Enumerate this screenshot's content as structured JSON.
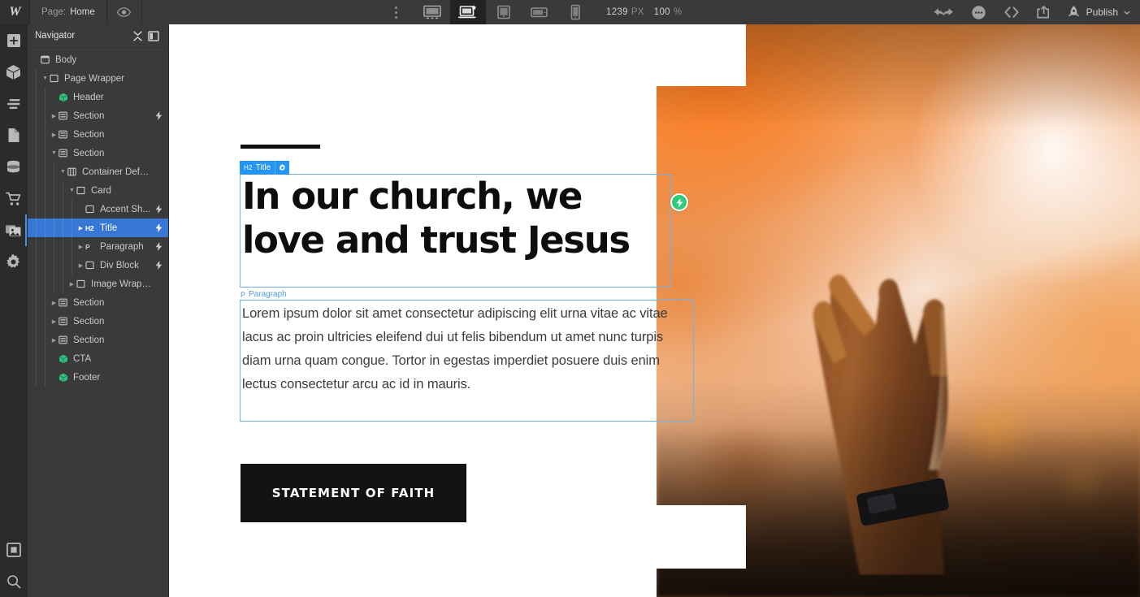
{
  "topbar": {
    "logo": "W",
    "page_label": "Page:",
    "page_value": "Home",
    "eye_icon": "eye-icon",
    "menu_icon": "vertical-dots-icon",
    "devices": [
      {
        "name": "desktop",
        "icon": "monitor-icon",
        "active": false
      },
      {
        "name": "base-breakpoint",
        "icon": "laptop-star-icon",
        "active": true
      },
      {
        "name": "tablet",
        "icon": "tablet-icon",
        "active": false
      },
      {
        "name": "mobile-landscape",
        "icon": "mobile-landscape-icon",
        "active": false
      },
      {
        "name": "mobile-portrait",
        "icon": "mobile-portrait-icon",
        "active": false
      }
    ],
    "viewport_width": "1239",
    "viewport_unit": "PX",
    "zoom_value": "100",
    "zoom_unit": "%",
    "undo_icon": "undo-arrow-icon",
    "redo_icon": "redo-arrow-icon",
    "comments_icon": "comment-bubble-icon",
    "code_icon": "code-brackets-icon",
    "share_icon": "share-export-icon",
    "rocket_icon": "rocket-icon",
    "publish_label": "Publish",
    "publish_chevron": "chevron-down-icon"
  },
  "rail": {
    "items": [
      {
        "name": "add-elements",
        "icon": "plus-square-icon",
        "active": false
      },
      {
        "name": "components",
        "icon": "cube-icon",
        "active": false
      },
      {
        "name": "navigator",
        "icon": "layers-list-icon",
        "active": false
      },
      {
        "name": "pages",
        "icon": "page-icon",
        "active": false
      },
      {
        "name": "cms",
        "icon": "database-icon",
        "active": false
      },
      {
        "name": "ecommerce",
        "icon": "shopping-cart-icon",
        "active": false
      },
      {
        "name": "assets",
        "icon": "image-stack-icon",
        "active": true
      },
      {
        "name": "settings",
        "icon": "gear-icon",
        "active": false
      }
    ],
    "bottom_items": [
      {
        "name": "audit-panel",
        "icon": "square-outline-icon"
      },
      {
        "name": "search",
        "icon": "magnifier-icon"
      }
    ]
  },
  "navigator": {
    "title": "Navigator",
    "collapse_icon": "collapse-all-icon",
    "panel_icon": "panel-toggle-icon",
    "tree": [
      {
        "label": "Body",
        "depth": 0,
        "icon": "body-icon",
        "arrow": "none",
        "bolt": false,
        "selected": false
      },
      {
        "label": "Page Wrapper",
        "depth": 1,
        "icon": "div-icon",
        "arrow": "down",
        "bolt": false,
        "selected": false
      },
      {
        "label": "Header",
        "depth": 2,
        "icon": "component-icon",
        "arrow": "none",
        "bolt": false,
        "selected": false
      },
      {
        "label": "Section",
        "depth": 2,
        "icon": "section-icon",
        "arrow": "right",
        "bolt": true,
        "selected": false
      },
      {
        "label": "Section",
        "depth": 2,
        "icon": "section-icon",
        "arrow": "right",
        "bolt": false,
        "selected": false
      },
      {
        "label": "Section",
        "depth": 2,
        "icon": "section-icon",
        "arrow": "down",
        "bolt": false,
        "selected": false
      },
      {
        "label": "Container Default",
        "depth": 3,
        "icon": "container-icon",
        "arrow": "down",
        "bolt": false,
        "selected": false
      },
      {
        "label": "Card",
        "depth": 4,
        "icon": "div-icon",
        "arrow": "down",
        "bolt": false,
        "selected": false
      },
      {
        "label": "Accent Sh...",
        "depth": 5,
        "icon": "div-icon",
        "arrow": "none",
        "bolt": true,
        "selected": false
      },
      {
        "label": "Title",
        "depth": 5,
        "icon": "h2-icon",
        "arrow": "right",
        "bolt": true,
        "selected": true
      },
      {
        "label": "Paragraph",
        "depth": 5,
        "icon": "p-icon",
        "arrow": "right",
        "bolt": true,
        "selected": false
      },
      {
        "label": "Div Block",
        "depth": 5,
        "icon": "div-icon",
        "arrow": "right",
        "bolt": true,
        "selected": false
      },
      {
        "label": "Image Wrapper",
        "depth": 4,
        "icon": "div-icon",
        "arrow": "right",
        "bolt": false,
        "selected": false
      },
      {
        "label": "Section",
        "depth": 2,
        "icon": "section-icon",
        "arrow": "right",
        "bolt": false,
        "selected": false
      },
      {
        "label": "Section",
        "depth": 2,
        "icon": "section-icon",
        "arrow": "right",
        "bolt": false,
        "selected": false
      },
      {
        "label": "Section",
        "depth": 2,
        "icon": "section-icon",
        "arrow": "right",
        "bolt": false,
        "selected": false
      },
      {
        "label": "CTA",
        "depth": 2,
        "icon": "component-icon",
        "arrow": "none",
        "bolt": false,
        "selected": false
      },
      {
        "label": "Footer",
        "depth": 2,
        "icon": "component-icon",
        "arrow": "none",
        "bolt": false,
        "selected": false
      }
    ]
  },
  "canvas": {
    "title_badge": {
      "tag": "H2",
      "name": "Title",
      "cog_icon": "gear-icon"
    },
    "paragraph_badge": {
      "tag": "P",
      "name": "Paragraph"
    },
    "heading": "In our church, we love and trust Jesus",
    "paragraph": "Lorem ipsum dolor sit amet consectetur adipiscing elit urna vitae ac vitae lacus ac proin ultricies eleifend dui ut felis bibendum ut amet nunc turpis diam urna quam congue. Tortor in egestas imperdiet posuere duis enim lectus consectetur arcu ac id in mauris.",
    "cta_label": "STATEMENT OF FAITH",
    "interaction_node_icon": "lightning-bolt-icon",
    "image_alt": "raised-hand-worship-photo"
  },
  "colors": {
    "accent_blue": "#2494f5",
    "selection_outline": "#6fb0f0",
    "nav_selected": "#3778d4",
    "interaction_green": "#2fcb7e",
    "cta_background": "#131313",
    "panel_background": "#3a3a3a",
    "topbar_background": "#3a3a3a"
  }
}
